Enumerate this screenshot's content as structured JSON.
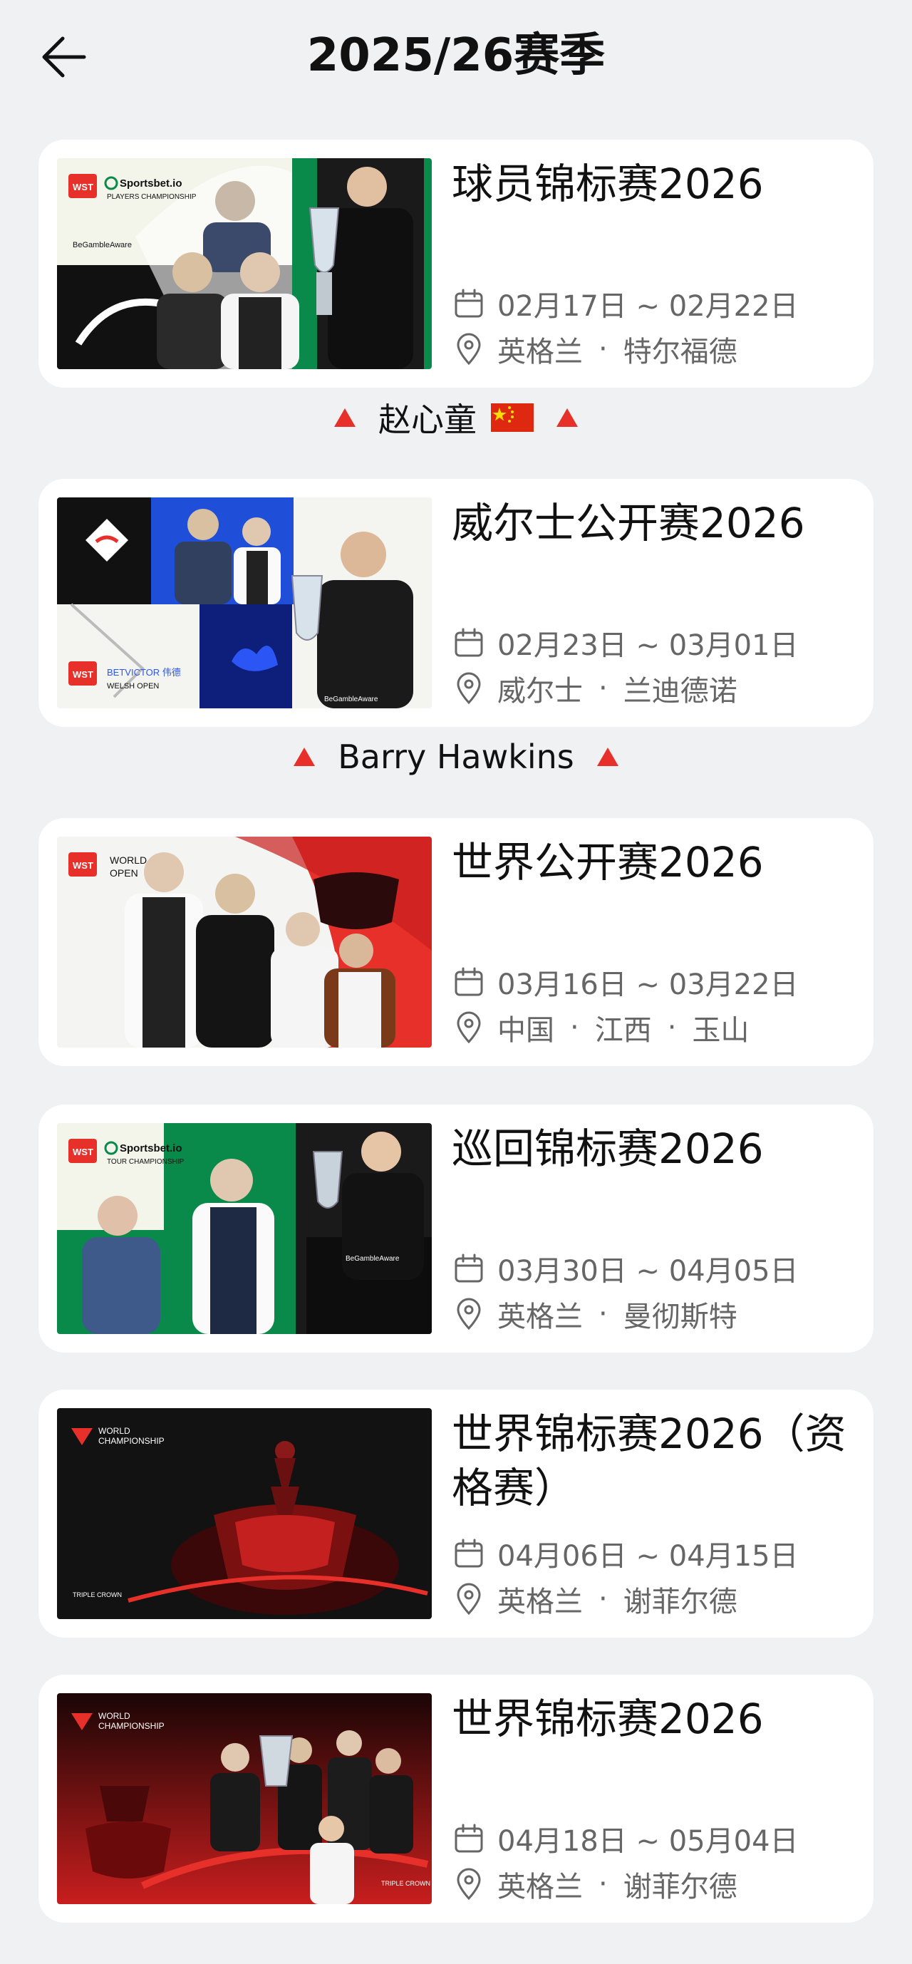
{
  "header": {
    "title": "2025/26赛季",
    "back_icon": "arrow-left-icon"
  },
  "events": [
    {
      "title": "球员锦标赛2026",
      "date": "02月17日 ~ 02月22日",
      "location": [
        "英格兰",
        "特尔福德"
      ],
      "poster": {
        "brand": "Sportsbet.io",
        "subtitle": "PLAYERS CHAMPIONSHIP",
        "tag": "BeGambleAware"
      },
      "winner": {
        "name": "赵心童",
        "flag": "china-flag-icon"
      }
    },
    {
      "title": "威尔士公开赛2026",
      "date": "02月23日 ~ 03月01日",
      "location": [
        "威尔士",
        "兰迪德诺"
      ],
      "poster": {
        "brand": "BETVICTOR 伟德",
        "subtitle": "WELSH OPEN",
        "tag": "BeGambleAware"
      },
      "winner": {
        "name": "Barry Hawkins"
      }
    },
    {
      "title": "世界公开赛2026",
      "date": "03月16日 ~ 03月22日",
      "location": [
        "中国",
        "江西",
        "玉山"
      ],
      "poster": {
        "brand": "WORLD",
        "subtitle": "OPEN"
      }
    },
    {
      "title": "巡回锦标赛2026",
      "date": "03月30日 ~ 04月05日",
      "location": [
        "英格兰",
        "曼彻斯特"
      ],
      "poster": {
        "brand": "Sportsbet.io",
        "subtitle": "TOUR CHAMPIONSHIP",
        "tag": "BeGambleAware"
      }
    },
    {
      "title": "世界锦标赛2026（资格赛）",
      "date": "04月06日 ~ 04月15日",
      "location": [
        "英格兰",
        "谢菲尔德"
      ],
      "poster": {
        "brand": "WORLD",
        "subtitle": "CHAMPIONSHIP",
        "tag": "TRIPLE CROWN"
      }
    },
    {
      "title": "世界锦标赛2026",
      "date": "04月18日 ~ 05月04日",
      "location": [
        "英格兰",
        "谢菲尔德"
      ],
      "poster": {
        "brand": "WORLD",
        "subtitle": "CHAMPIONSHIP",
        "tag": "TRIPLE CROWN"
      }
    }
  ],
  "icons": {
    "date": "calendar-icon",
    "location": "location-pin-icon",
    "winner_marker": "red-triangle-icon"
  },
  "colors": {
    "accent_red": "#e8302a",
    "meta_gray": "#666666",
    "background": "#f0f1f3"
  }
}
